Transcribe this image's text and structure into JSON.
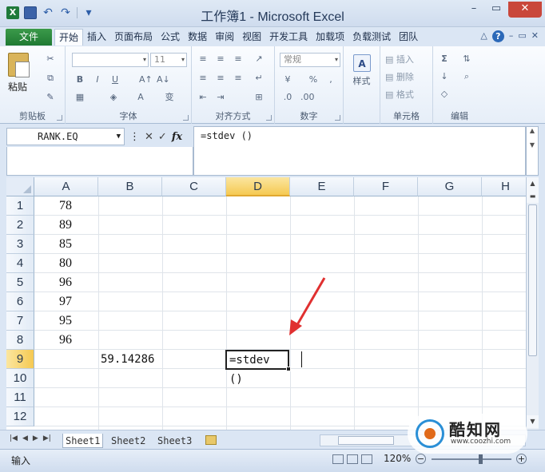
{
  "window": {
    "title": "工作簿1 - Microsoft Excel",
    "controls": [
      "–",
      "▭",
      "✕"
    ]
  },
  "ribbon": {
    "file_tab": "文件",
    "tabs": [
      "开始",
      "插入",
      "页面布局",
      "公式",
      "数据",
      "审阅",
      "视图",
      "开发工具",
      "加载项",
      "负载测试",
      "团队"
    ],
    "active_tab": "开始",
    "groups": {
      "clipboard": {
        "label": "剪贴板",
        "paste": "粘贴"
      },
      "font": {
        "label": "字体",
        "size": "11"
      },
      "alignment": {
        "label": "对齐方式"
      },
      "number": {
        "label": "数字",
        "format": "常规"
      },
      "styles": {
        "label": "样式"
      },
      "cells": {
        "label": "单元格",
        "insert": "插入",
        "delete": "删除",
        "format": "格式"
      },
      "editing": {
        "label": "编辑"
      }
    }
  },
  "formula_bar": {
    "name_box": "RANK.EQ",
    "formula": "=stdev ()"
  },
  "grid": {
    "columns": [
      "A",
      "B",
      "C",
      "D",
      "E",
      "F",
      "G",
      "H"
    ],
    "selected_column": "D",
    "rows": [
      "1",
      "2",
      "3",
      "4",
      "5",
      "6",
      "7",
      "8",
      "9",
      "10",
      "11",
      "12"
    ],
    "selected_row": "9",
    "column_a_values": [
      "78",
      "89",
      "85",
      "80",
      "96",
      "97",
      "95",
      "96"
    ],
    "b9": "59.14286",
    "d9": "=stdev ()"
  },
  "sheets": {
    "tabs": [
      "Sheet1",
      "Sheet2",
      "Sheet3"
    ],
    "active": "Sheet1"
  },
  "status": {
    "mode": "输入",
    "zoom": "120%"
  },
  "watermark": {
    "name": "酷知网",
    "url": "www.coozhi.com"
  }
}
